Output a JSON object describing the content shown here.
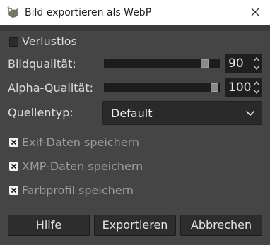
{
  "window": {
    "title": "Bild exportieren als WebP",
    "app_icon": "gimp-icon",
    "close_icon": "close-icon"
  },
  "options": {
    "lossless": {
      "label": "Verlustlos",
      "checked": false
    },
    "image_quality": {
      "label": "Bildqualität:",
      "value": "90",
      "min": 0,
      "max": 100,
      "level": 0.9
    },
    "alpha_quality": {
      "label": "Alpha-Qualität:",
      "value": "100",
      "min": 0,
      "max": 100,
      "level": 1.0
    },
    "source_type": {
      "label": "Quellentyp:",
      "selected": "Default"
    },
    "save_exif": {
      "label": "Exif-Daten speichern",
      "checked": true
    },
    "save_xmp": {
      "label": "XMP-Daten speichern",
      "checked": true
    },
    "save_color_profile": {
      "label": "Farbprofil speichern",
      "checked": true
    }
  },
  "buttons": {
    "help": "Hilfe",
    "export": "Exportieren",
    "cancel": "Abbrechen"
  },
  "colors": {
    "dialog_bg": "#454545",
    "titlebar_bg": "#ffffff",
    "field_bg": "#1f1f1f",
    "text": "#dcdcdc",
    "dim_text": "#9d9d9d"
  }
}
